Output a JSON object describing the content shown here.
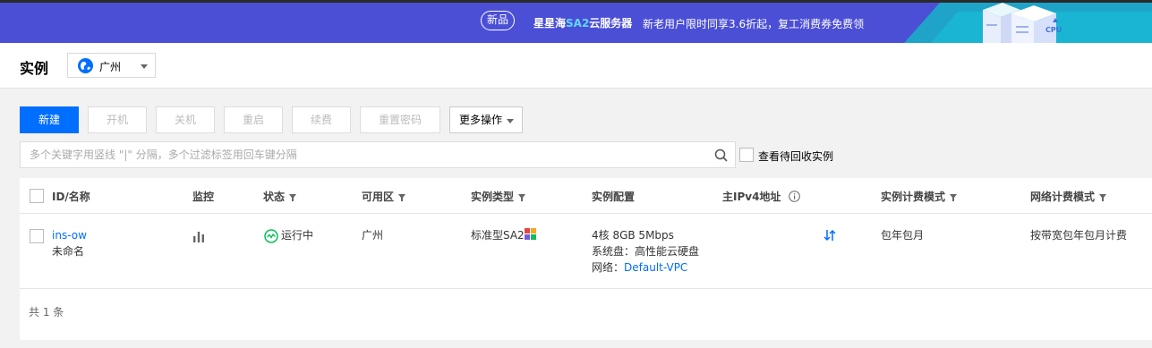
{
  "banner": {
    "badge": "新品",
    "promo_part1": "星星海",
    "promo_part2": "SA2",
    "promo_part3": "云服务器",
    "promo_desc": "新老用户限时同享3.6折起，复工消费券免费领",
    "deco_text": "CPU",
    "colors": {
      "bg": "#4b4fd6",
      "accent": "#5fd7ff"
    }
  },
  "header": {
    "title": "实例",
    "region": "广州",
    "region_icon": "globe-icon"
  },
  "toolbar": {
    "create": "新建",
    "power_on": "开机",
    "power_off": "关机",
    "restart": "重启",
    "renew": "续费",
    "reset_password": "重置密码",
    "more": "更多操作"
  },
  "search": {
    "placeholder": "多个关键字用竖线 \"|\" 分隔，多个过滤标签用回车键分隔",
    "value": "",
    "icon": "search-icon"
  },
  "recycle_label": "查看待回收实例",
  "table": {
    "columns": {
      "id": "ID/名称",
      "monitor": "监控",
      "status": "状态",
      "zone": "可用区",
      "type": "实例类型",
      "config": "实例配置",
      "ip": "主IPv4地址",
      "billing": "实例计费模式",
      "network_billing": "网络计费模式"
    },
    "rows": [
      {
        "id": "ins-ow",
        "name": "未命名",
        "status": "运行中",
        "zone": "广州",
        "type": "标准型SA2",
        "config_line1": "4核 8GB 5Mbps",
        "config_line2": "系统盘：高性能云硬盘",
        "config_line3_label": "网络：",
        "config_line3_link": "Default-VPC",
        "billing": "包年包月",
        "network_billing": "按带宽包年包月计费"
      }
    ],
    "footer": "共 1 条"
  },
  "colors": {
    "primary": "#006eff",
    "running": "#0abf5b"
  }
}
